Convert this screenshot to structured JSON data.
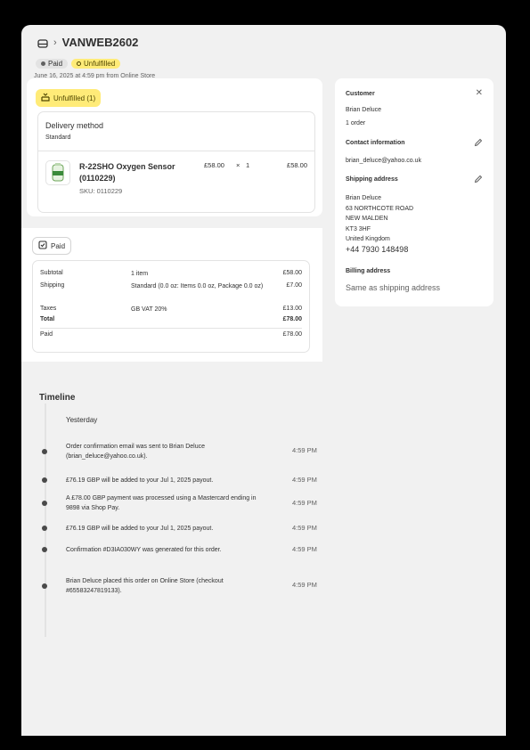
{
  "order": {
    "title": "VANWEB2602",
    "badge_paid": "Paid",
    "badge_unfulfilled": "Unfulfilled",
    "date_line": "June 16, 2025 at 4:59 pm from Online Store"
  },
  "fulfillment": {
    "status_label": "Unfulfilled (1)",
    "delivery_method_label": "Delivery method",
    "delivery_method_value": "Standard",
    "product": {
      "name": "R-22SHO Oxygen Sensor (0110229)",
      "sku": "SKU: 0110229",
      "unit_price": "£58.00",
      "times": "×",
      "quantity": "1",
      "line_total": "£58.00"
    }
  },
  "payment": {
    "status_label": "Paid",
    "rows": [
      {
        "label": "Subtotal",
        "desc": "1 item",
        "amount": "£58.00"
      },
      {
        "label": "Shipping",
        "desc": "Standard (0.0 oz: Items 0.0 oz, Package 0.0 oz)",
        "amount": "£7.00"
      },
      {
        "label": "Taxes",
        "desc": "GB VAT 20%",
        "amount": "£13.00"
      },
      {
        "label": "Total",
        "desc": "",
        "amount": "£78.00"
      },
      {
        "label": "Paid",
        "desc": "",
        "amount": "£78.00"
      }
    ]
  },
  "customer": {
    "section_title": "Customer",
    "name": "Brian Deluce",
    "orders": "1 order",
    "contact_title": "Contact information",
    "email": "brian_deluce@yahoo.co.uk",
    "shipping_title": "Shipping address",
    "address_lines": [
      "Brian Deluce",
      "63 NORTHCOTE ROAD",
      "NEW MALDEN",
      "KT3 3HF",
      "United Kingdom"
    ],
    "phone": "+44 7930 148498",
    "billing_title": "Billing address",
    "billing_value": "Same as shipping address"
  },
  "timeline": {
    "title": "Timeline",
    "day": "Yesterday",
    "events": [
      {
        "text": "Order confirmation email was sent to Brian Deluce (brian_deluce@yahoo.co.uk).",
        "time": "4:59 PM"
      },
      {
        "text": "£76.19 GBP will be added to your Jul 1, 2025 payout.",
        "time": "4:59 PM"
      },
      {
        "text": "A £78.00 GBP payment was processed using a Mastercard ending in 9898 via Shop Pay.",
        "time": "4:59 PM"
      },
      {
        "text": "£76.19 GBP will be added to your Jul 1, 2025 payout.",
        "time": "4:59 PM"
      },
      {
        "text": "Confirmation #D3IA030WY was generated for this order.",
        "time": "4:59 PM"
      },
      {
        "text": "Brian Deluce placed this order on Online Store (checkout #65583247819133).",
        "time": "4:59 PM"
      }
    ]
  }
}
